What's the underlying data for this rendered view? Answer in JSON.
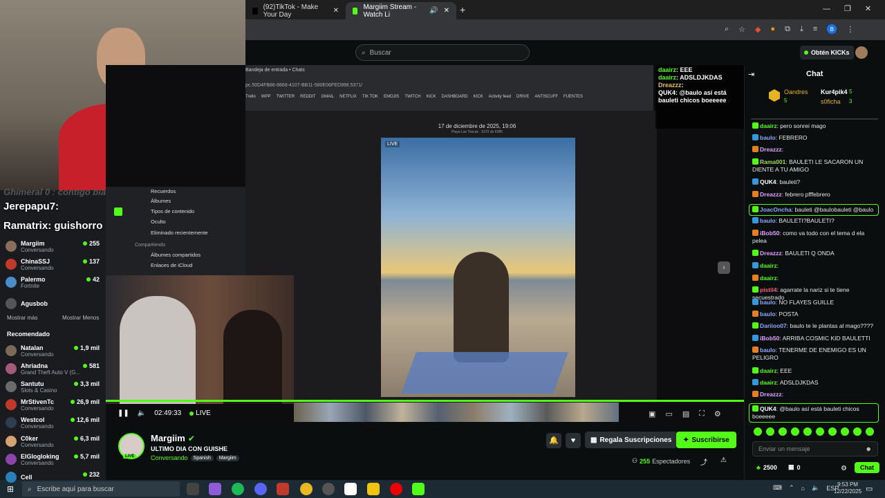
{
  "browser": {
    "tabs": [
      {
        "label": "(92)TikTok - Make Your Day"
      },
      {
        "label": "Margiim Stream - Watch Li"
      }
    ],
    "profile_initial": "B"
  },
  "site": {
    "search_placeholder": "Buscar",
    "get_kicks": "Obtén KICKs"
  },
  "webcam_overlay": {
    "lines": [
      {
        "user": "Jerepapu7",
        "text": ":"
      },
      {
        "user": "Ramatrix",
        "text": ": guishorro"
      }
    ],
    "faded_line": "Ghimeral 0 : contigo blanco"
  },
  "sidebar": {
    "channels": [
      {
        "name": "Margiim",
        "sub": "Conversando",
        "count": "255",
        "color": "#8a6e5c"
      },
      {
        "name": "ChinaSSJ",
        "sub": "Conversando",
        "count": "137",
        "color": "#c0392b"
      },
      {
        "name": "Palermo",
        "sub": "Fortnite",
        "count": "42",
        "color": "#4a8cc7"
      },
      {
        "name": "Agusbob",
        "sub": "",
        "count": "",
        "color": "#555"
      }
    ],
    "show_more": "Mostrar más",
    "show_less": "Mostrar Menos",
    "recommended_title": "Recomendado",
    "recommended": [
      {
        "name": "Natalan",
        "sub": "Conversando",
        "count": "1,9 mil",
        "color": "#7a6a5a"
      },
      {
        "name": "Ahriadna",
        "sub": "Grand Theft Auto V (G...",
        "count": "581",
        "color": "#a05a7a"
      },
      {
        "name": "Santutu",
        "sub": "Slots & Casino",
        "count": "3,3 mil",
        "color": "#6a6a6a"
      },
      {
        "name": "MrStivenTc",
        "sub": "Conversando",
        "count": "26,9 mil",
        "color": "#c0392b"
      },
      {
        "name": "Westcol",
        "sub": "Conversando",
        "count": "12,6 mil",
        "color": "#2c3e50"
      },
      {
        "name": "C0ker",
        "sub": "Conversando",
        "count": "6,3 mil",
        "color": "#d4a373"
      },
      {
        "name": "ElGlogloking",
        "sub": "Conversando",
        "count": "5,7 mil",
        "color": "#8e44ad"
      },
      {
        "name": "Cell",
        "sub": "",
        "count": "232",
        "color": "#2980b9"
      }
    ]
  },
  "mac_sidebar": {
    "items": [
      "Recuerdos",
      "Álbumes",
      "Tipos de contenido",
      "Oculto",
      "Eliminado recientemente"
    ],
    "section": "Compartiendo",
    "shared": [
      "Álbumes compartidos",
      "Enlaces de iCloud"
    ]
  },
  "shared_screen": {
    "tab_title": "Bandeja de entrada • Chats",
    "url": "pc.50D4FB86-8868-4107-BB11-580E06FED998.5371/",
    "bookmarks": [
      "Trello",
      "WPP",
      "TWITTER",
      "REDDIT",
      "GMAIL",
      "NETFLIX",
      "TIK TOK",
      "EMOJIS",
      "TWITCH",
      "KICK",
      "DASHBOARD",
      "KICK",
      "Activity feed",
      "DRIVE",
      "ANTISCUFF",
      "FUENTES"
    ],
    "photo_date": "17 de diciembre de 2025, 19:06",
    "photo_location": "Playa Las Toscas · 5372 de 6385",
    "live_label": "LIVE"
  },
  "video_chat_overlay": [
    {
      "user": "daairz",
      "text": ": EEE",
      "color": "#53fc18"
    },
    {
      "user": "daairz",
      "text": ": ADSLDJKDAS",
      "color": "#53fc18"
    },
    {
      "user": "Dreazzz",
      "text": ":",
      "color": "#e7c14b"
    },
    {
      "user": "QUK4",
      "text": ": @baulo así está bauleti chicos boeeeee",
      "color": "#ffffff"
    }
  ],
  "player": {
    "time": "02:49:33",
    "live": "LIVE"
  },
  "stream_info": {
    "streamer": "Margiim",
    "title": "ULTIMO DIA CON GUISHE",
    "category": "Conversando",
    "tags": [
      "Spanish",
      "Margiim"
    ],
    "live_badge": "LIVE",
    "gift_subs": "Regala Suscripciones",
    "subscribe": "Suscribirse",
    "viewers": "255",
    "viewers_label": "Espectadores"
  },
  "chat": {
    "title": "Chat",
    "top_gifters": [
      {
        "name": "Oandres",
        "count": "5"
      },
      {
        "name": "Kur4pik4",
        "count": "5"
      },
      {
        "name": "s0ficha",
        "count": "3"
      }
    ],
    "messages": [
      {
        "user": "daairz",
        "text": ": pero sonrei mago",
        "color": "#53fc18"
      },
      {
        "user": "baulo",
        "text": ": FEBRERO",
        "color": "#8da8ff"
      },
      {
        "user": "Dreazzz",
        "text": ":",
        "color": "#e0a0ff"
      },
      {
        "user": "Rama001",
        "text": ": BAULETI LE SACARON UN DIENTE A TU AMIGO",
        "color": "#9cdb54"
      },
      {
        "user": "QUK4",
        "text": ": bauleti?",
        "color": "#ffffff"
      },
      {
        "user": "Dreazzz",
        "text": ": febrero pfffebrero",
        "color": "#e0a0ff"
      },
      {
        "user": "JoacOncha",
        "text": ": bauleti @baulobauleti @baulo",
        "color": "#8da8ff"
      },
      {
        "user": "baulo",
        "text": ": BAULETI?BAULETI?",
        "color": "#8da8ff"
      },
      {
        "user": "iBob50",
        "text": ": como va todo con el tema d ela pelea",
        "color": "#e0a0ff"
      },
      {
        "user": "Dreazzz",
        "text": ": BAULETI Q ONDA",
        "color": "#e0a0ff"
      },
      {
        "user": "daairz",
        "text": ":",
        "color": "#53fc18"
      },
      {
        "user": "daairz",
        "text": ":",
        "color": "#53fc18"
      },
      {
        "user": "pistil4",
        "text": ": agarrate la nariz si te tiene secuestrado",
        "color": "#ff5c7c"
      },
      {
        "user": "baulo",
        "text": ": NO FLAYES GUILLE",
        "color": "#8da8ff"
      },
      {
        "user": "baulo",
        "text": ": POSTA",
        "color": "#8da8ff"
      },
      {
        "user": "Dariioo07",
        "text": ": baulo te le plantas al mago????",
        "color": "#8da8ff"
      },
      {
        "user": "iBob50",
        "text": ": ARRIBA COSMIC KID BAULETTI",
        "color": "#e0a0ff"
      },
      {
        "user": "baulo",
        "text": ": TENERME DE ENEMIGO ES UN PELIGRO",
        "color": "#8da8ff"
      },
      {
        "user": "daairz",
        "text": ": EEE",
        "color": "#53fc18"
      },
      {
        "user": "daairz",
        "text": ": ADSLDJKDAS",
        "color": "#53fc18"
      },
      {
        "user": "Dreazzz",
        "text": ":",
        "color": "#e0a0ff"
      },
      {
        "user": "QUK4",
        "text": ": @baulo así está bauleti chicos boeeeee",
        "color": "#ffffff"
      }
    ],
    "input_placeholder": "Enviar un mensaje",
    "kicks": "2500",
    "gifts": "0",
    "send": "Chat"
  },
  "taskbar": {
    "search_placeholder": "Escribe aquí para buscar",
    "lang": "ESP",
    "time": "9:53 PM",
    "date": "12/22/2025"
  },
  "colors": {
    "accent": "#53fc18",
    "bg": "#0b0e0f",
    "panel": "#191b1f"
  }
}
